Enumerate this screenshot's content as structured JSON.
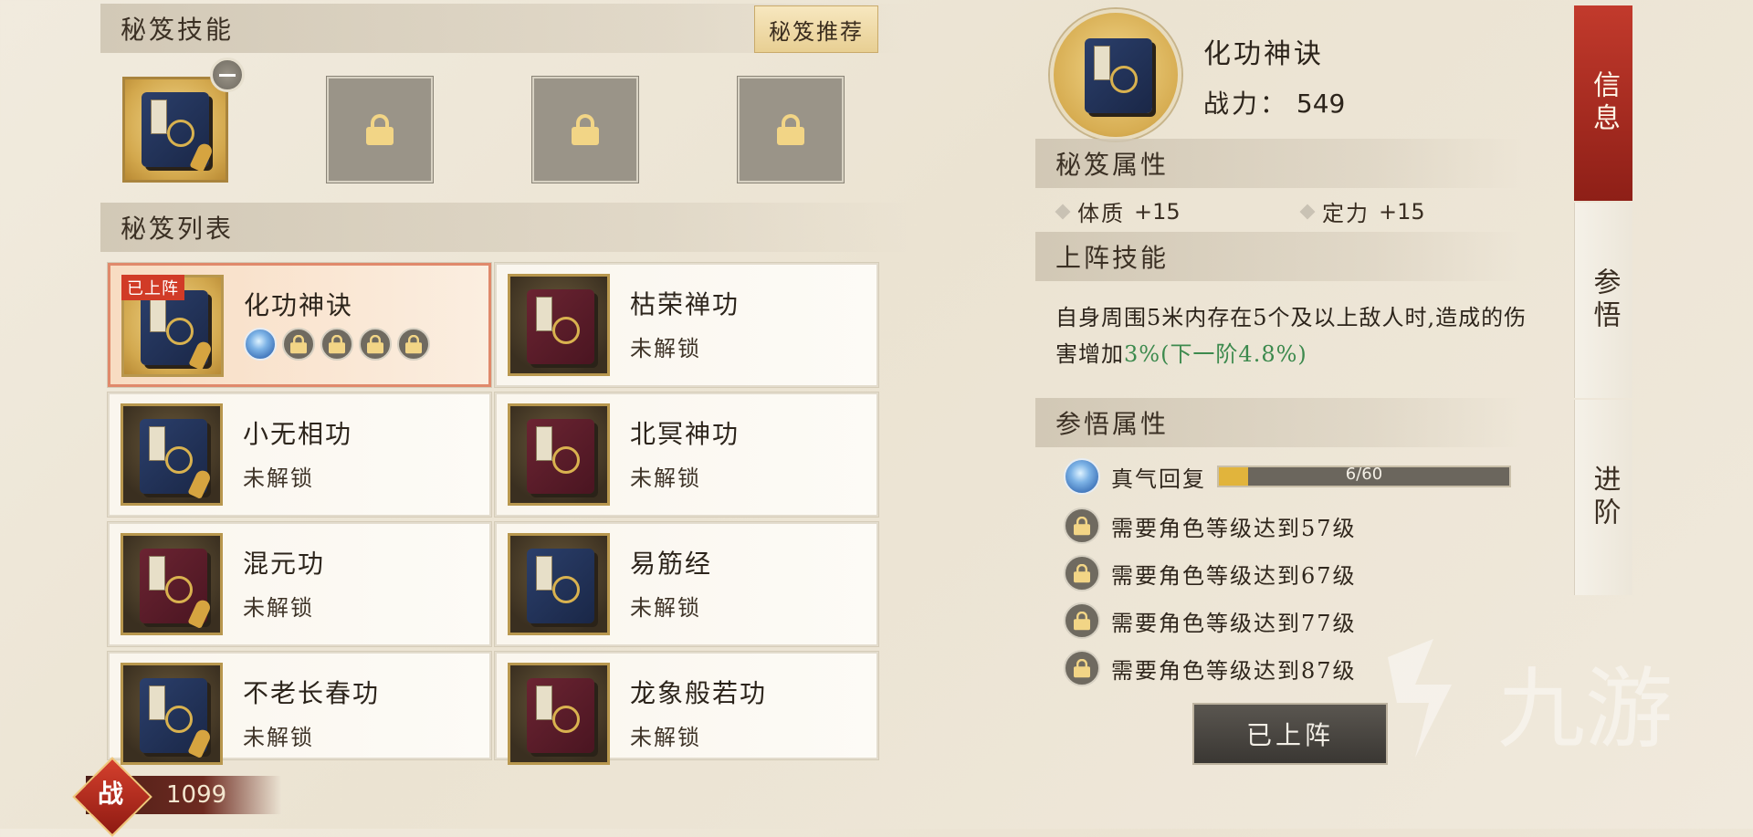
{
  "left": {
    "skills_header": "秘笈技能",
    "recommend_button": "秘笈推荐",
    "list_header": "秘笈列表",
    "cards": [
      {
        "name": "化功神诀",
        "status": "",
        "badge": "已上阵",
        "selected": true,
        "cover": "navy"
      },
      {
        "name": "枯荣禅功",
        "status": "未解锁",
        "cover": "red"
      },
      {
        "name": "小无相功",
        "status": "未解锁",
        "cover": "navy"
      },
      {
        "name": "北冥神功",
        "status": "未解锁",
        "cover": "red"
      },
      {
        "name": "混元功",
        "status": "未解锁",
        "cover": "red"
      },
      {
        "name": "易筋经",
        "status": "未解锁",
        "cover": "navy"
      },
      {
        "name": "不老长春功",
        "status": "未解锁",
        "cover": "navy"
      },
      {
        "name": "龙象般若功",
        "status": "未解锁",
        "cover": "red"
      }
    ]
  },
  "right": {
    "title": "化功神诀",
    "power_label": "战力：",
    "power_value": "549",
    "attr_header": "秘笈属性",
    "attrs": [
      {
        "name": "体质",
        "value": "+15"
      },
      {
        "name": "定力",
        "value": "+15"
      }
    ],
    "skill_header": "上阵技能",
    "skill_desc_main": "自身周围5米内存在5个及以上敌人时,造成的伤害增加",
    "skill_desc_value": "3%(下一阶4.8%)",
    "comprehend_header": "参悟属性",
    "progress": {
      "label": "真气回复",
      "text": "6/60",
      "fraction": 0.1
    },
    "requirements": [
      "需要角色等级达到57级",
      "需要角色等级达到67级",
      "需要角色等级达到77级",
      "需要角色等级达到87级"
    ],
    "deploy_button": "已上阵"
  },
  "tabs": [
    "信息",
    "参悟",
    "进阶"
  ],
  "bottom": {
    "badge": "战",
    "power": "1099"
  },
  "watermark": "九游",
  "colors": {
    "accent_red": "#c23a2c",
    "gold": "#e1b43c",
    "highlight_green": "#3d8a4e"
  }
}
